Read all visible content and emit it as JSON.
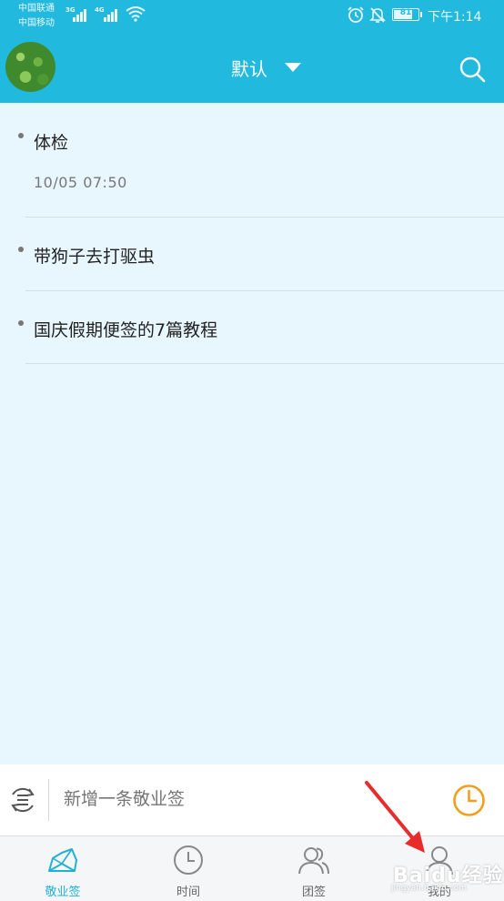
{
  "status_bar": {
    "carrier_1": "中国联通",
    "carrier_2": "中国移动",
    "net_1": "3G",
    "net_2": "4G",
    "battery": "81",
    "battery_level": 0.81,
    "time": "下午1:14",
    "icons": [
      "signal-icon",
      "wifi-icon",
      "alarm-icon",
      "mute-bell-icon",
      "battery-icon"
    ]
  },
  "header": {
    "title": "默认",
    "dropdown_icon": "caret-down-icon",
    "search_icon": "search-icon",
    "accent_color": "#21b9de"
  },
  "notes": [
    {
      "title": "体检",
      "time": "10/05  07:50"
    },
    {
      "title": "带狗子去打驱虫",
      "time": ""
    },
    {
      "title": "国庆假期便签的7篇教程",
      "time": ""
    }
  ],
  "composer": {
    "placeholder": "新增一条敬业签",
    "sort_icon": "sort-cycle-icon",
    "clock_icon": "clock-icon",
    "clock_color": "#f0a020"
  },
  "tabs": [
    {
      "label": "敬业签",
      "icon": "notes-icon",
      "active": true
    },
    {
      "label": "时间",
      "icon": "clock-icon",
      "active": false
    },
    {
      "label": "团签",
      "icon": "team-icon",
      "active": false
    },
    {
      "label": "我的",
      "icon": "person-icon",
      "active": false
    }
  ],
  "watermark": {
    "text": "Baidu经验",
    "sub": "jingyan.baidu.com"
  }
}
